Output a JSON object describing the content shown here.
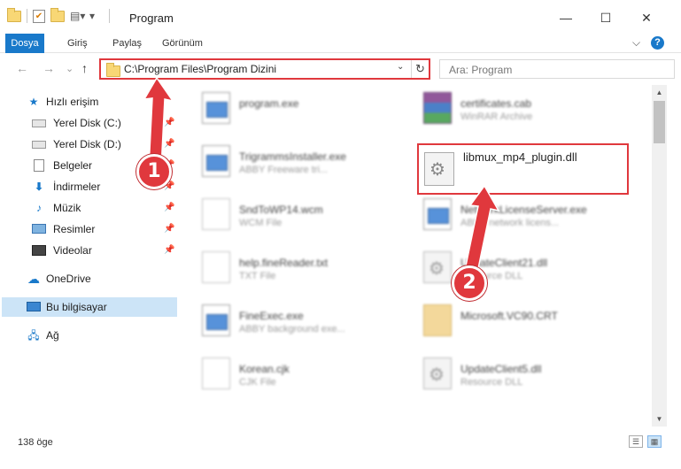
{
  "window": {
    "title": "Program",
    "minimize": "—",
    "maximize": "☐",
    "close": "✕"
  },
  "ribbon": {
    "tabs": [
      "Dosya",
      "Giriş",
      "Paylaş",
      "Görünüm"
    ],
    "expand": "⌵",
    "help": "?"
  },
  "navigation": {
    "back": "←",
    "forward": "→",
    "recent": "⌄",
    "up": "↑",
    "address": "C:\\Program Files\\Program Dizini",
    "address_dropdown": "⌄",
    "refresh": "↻",
    "search_placeholder": "Ara: Program"
  },
  "sidebar": {
    "items": [
      {
        "label": "Hızlı erişim",
        "icon": "star-icon",
        "pinned": false
      },
      {
        "label": "Yerel Disk (C:)",
        "icon": "drive-icon",
        "pinned": true
      },
      {
        "label": "Yerel Disk (D:)",
        "icon": "drive-icon",
        "pinned": true
      },
      {
        "label": "Belgeler",
        "icon": "documents-icon",
        "pinned": true
      },
      {
        "label": "İndirmeler",
        "icon": "download-icon",
        "pinned": true
      },
      {
        "label": "Müzik",
        "icon": "music-icon",
        "pinned": true
      },
      {
        "label": "Resimler",
        "icon": "pictures-icon",
        "pinned": true
      },
      {
        "label": "Videolar",
        "icon": "videos-icon",
        "pinned": true
      },
      {
        "label": "OneDrive",
        "icon": "cloud-icon",
        "pinned": false
      },
      {
        "label": "Bu bilgisayar",
        "icon": "computer-icon",
        "pinned": false
      },
      {
        "label": "Ağ",
        "icon": "network-icon",
        "pinned": false
      }
    ],
    "pin_glyph": "📌"
  },
  "files": {
    "left": [
      {
        "name": "program.exe",
        "type": "",
        "icon": "exe-icon"
      },
      {
        "name": "TrigrammsInstaller.exe",
        "type": "ABBY Freeware tri...",
        "icon": "exe-icon"
      },
      {
        "name": "SndToWP14.wcm",
        "type": "WCM File",
        "icon": "document-icon"
      },
      {
        "name": "help.fineReader.txt",
        "type": "TXT File",
        "icon": "document-icon"
      },
      {
        "name": "FineExec.exe",
        "type": "ABBY background exe...",
        "icon": "exe-icon"
      },
      {
        "name": "Korean.cjk",
        "type": "CJK File",
        "icon": "document-icon"
      }
    ],
    "right": [
      {
        "name": "certificates.cab",
        "type": "WinRAR Archive",
        "icon": "archive-icon"
      },
      {
        "name": "NetworkLicenseServer.exe",
        "type": "ABBY network licens...",
        "icon": "exe-icon"
      },
      {
        "name": "UpdateClient21.dll",
        "type": "Resource DLL",
        "icon": "dll-icon"
      },
      {
        "name": "Microsoft.VC90.CRT",
        "type": "",
        "icon": "folder-icon"
      },
      {
        "name": "UpdateClient5.dll",
        "type": "Resource DLL",
        "icon": "dll-icon"
      }
    ],
    "highlighted": {
      "name": "libmux_mp4_plugin.dll",
      "icon": "dll-icon"
    }
  },
  "annotations": {
    "step1": "1",
    "step2": "2",
    "color": "#e0383d"
  },
  "status": {
    "count": "138 öge",
    "details_view": "☰",
    "icons_view": "▦"
  },
  "colors": {
    "accent": "#1979ca",
    "selection": "#cce4f7",
    "highlight": "#e0383d"
  }
}
